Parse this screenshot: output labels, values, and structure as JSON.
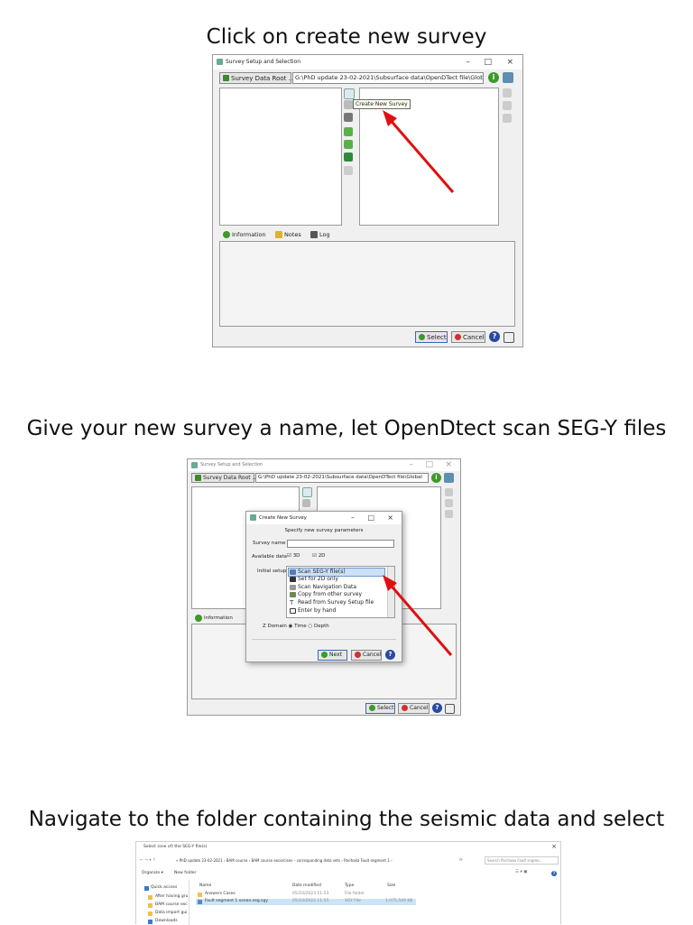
{
  "captions": {
    "step1": "Click on create new survey",
    "step2": "Give your new survey a name, let OpenDtect scan SEG-Y files",
    "step3": "Navigate to the folder containing the seismic data and select"
  },
  "survey_window": {
    "title": "Survey Setup and Selection",
    "minimize": "–",
    "maximize": "□",
    "close": "×",
    "data_root_button": "Survey Data Root ...",
    "data_root_path": "G:\\PhD update 23-02-2021\\Subsurface data\\OpenDTect file\\Global",
    "tabs": [
      "Information",
      "Notes",
      "Log"
    ],
    "select_button": "Select",
    "cancel_button": "Cancel"
  },
  "tooltip": "Create New Survey",
  "new_survey_dialog": {
    "title": "Create New Survey",
    "heading": "Specify new survey parameters",
    "survey_name_label": "Survey name",
    "survey_name_value": "",
    "available_data_label": "Available data",
    "opt_3d": "3D",
    "opt_2d": "2D",
    "initial_setup_label": "Initial setup",
    "setup_options": [
      "Scan SEG-Y file(s)",
      "Set for 2D only",
      "Scan Navigation Data",
      "Copy from other survey",
      "Read from Survey Setup file",
      "Enter by hand"
    ],
    "z_domain_label": "Z Domain",
    "z_time": "Time",
    "z_depth": "Depth",
    "next_button": "Next",
    "cancel_button": "Cancel"
  },
  "file_dialog": {
    "title": "Select (one of) the SEG-Y file(s)",
    "breadcrumb": "« PhD update 23-02-2021 › BAM course › BAM course excercises – corresponding data sets › Parihaka Fault segment 1 ›",
    "search_placeholder": "Search Parihaka Fault segme...",
    "organize": "Organize ▾",
    "new_folder": "New folder",
    "columns": [
      "Name",
      "Date modified",
      "Type",
      "Size"
    ],
    "rows": [
      {
        "name": "Answers Cases",
        "date": "05/10/2023 11:53",
        "type": "File folder",
        "size": ""
      },
      {
        "name": "Fault segment 1 ocean.seg.sgy",
        "date": "05/10/2023 11:55",
        "type": "SGY File",
        "size": "1,075,549 KB"
      }
    ],
    "nav_items": [
      "Quick access",
      "After having gru",
      "BAM course exc",
      "Data import gui",
      "Downloads"
    ]
  }
}
